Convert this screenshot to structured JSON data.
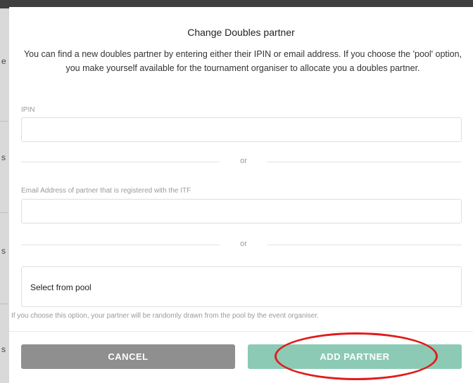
{
  "modal": {
    "title": "Change Doubles partner",
    "description": "You can find a new doubles partner by entering either their IPIN or email address. If you choose the 'pool' option, you make yourself available for the tournament organiser to allocate you a doubles partner."
  },
  "form": {
    "ipin_label": "IPIN",
    "ipin_value": "",
    "or_text_1": "or",
    "email_label": "Email Address of partner that is registered with the ITF",
    "email_value": "",
    "or_text_2": "or",
    "pool_label": "Select from pool",
    "pool_note": "If you choose this option, your partner will be randomly drawn from the pool by the event organiser."
  },
  "buttons": {
    "cancel": "CANCEL",
    "add_partner": "ADD PARTNER"
  },
  "colors": {
    "cancel_bg": "#8f8f8f",
    "add_partner_bg": "#8ccab5",
    "highlight_ring": "#e11c1c"
  },
  "background": {
    "side_glyphs": [
      "e",
      "s",
      "s",
      "s"
    ]
  }
}
